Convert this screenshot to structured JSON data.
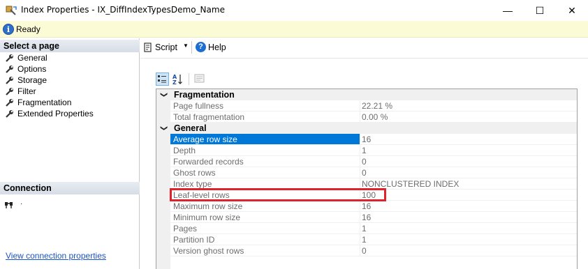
{
  "window": {
    "title": "Index Properties - IX_DiffIndexTypesDemo_Name",
    "minimize_glyph": "—",
    "maximize_glyph": "☐",
    "close_glyph": "✕"
  },
  "status": {
    "text": "Ready",
    "icon": "info-icon"
  },
  "left_pane": {
    "select_page_header": "Select a page",
    "pages": [
      {
        "label": "General"
      },
      {
        "label": "Options"
      },
      {
        "label": "Storage"
      },
      {
        "label": "Filter"
      },
      {
        "label": "Fragmentation"
      },
      {
        "label": "Extended Properties"
      }
    ],
    "connection_header": "Connection",
    "connection_value": "·",
    "view_connection_link": "View connection properties"
  },
  "toolbar": {
    "script_label": "Script",
    "help_label": "Help"
  },
  "property_grid": {
    "categories": [
      {
        "label": "Fragmentation",
        "properties": [
          {
            "name": "Page fullness",
            "value": "22.21 %"
          },
          {
            "name": "Total fragmentation",
            "value": "0.00 %"
          }
        ]
      },
      {
        "label": "General",
        "properties": [
          {
            "name": "Average row size",
            "value": "16",
            "selected": true
          },
          {
            "name": "Depth",
            "value": "1"
          },
          {
            "name": "Forwarded records",
            "value": "0"
          },
          {
            "name": "Ghost rows",
            "value": "0"
          },
          {
            "name": "Index type",
            "value": "NONCLUSTERED INDEX"
          },
          {
            "name": "Leaf-level rows",
            "value": "100",
            "highlighted": true
          },
          {
            "name": "Maximum row size",
            "value": "16"
          },
          {
            "name": "Minimum row size",
            "value": "16"
          },
          {
            "name": "Pages",
            "value": "1"
          },
          {
            "name": "Partition ID",
            "value": "1"
          },
          {
            "name": "Version ghost rows",
            "value": "0"
          }
        ]
      }
    ]
  },
  "colors": {
    "status_bar_bg": "#fbfbd6",
    "selected_row": "#0078d7",
    "highlight_box": "#e0222b",
    "link": "#1a53c7"
  }
}
